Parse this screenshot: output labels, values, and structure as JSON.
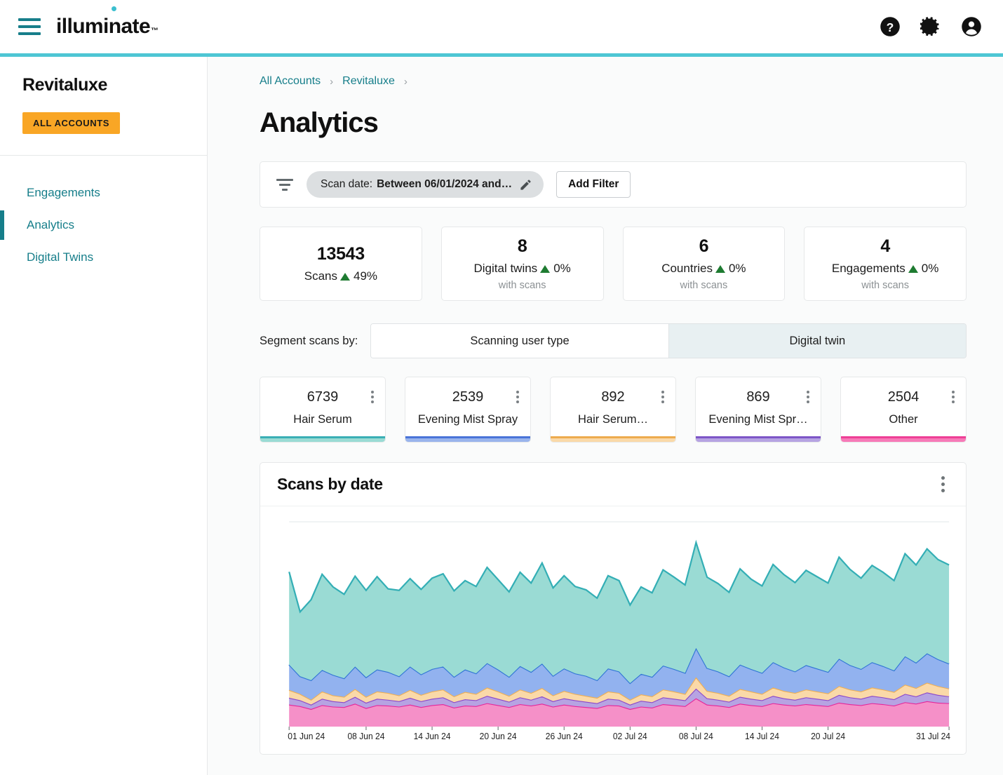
{
  "topbar": {
    "menu_label": "Menu",
    "logo_text": "illuminate",
    "logo_tm": "™",
    "icons": [
      "help-icon",
      "gear-icon",
      "account-icon"
    ],
    "accent_color": "#4ec6d4"
  },
  "sidebar": {
    "account_name": "Revitaluxe",
    "all_accounts_badge": "ALL ACCOUNTS",
    "badge_color": "#f9a625",
    "items": [
      {
        "label": "Engagements",
        "active": false
      },
      {
        "label": "Analytics",
        "active": true
      },
      {
        "label": "Digital Twins",
        "active": false
      }
    ],
    "link_color": "#167e8a"
  },
  "breadcrumb": {
    "items": [
      "All Accounts",
      "Revitaluxe"
    ],
    "separator": "›",
    "trailing_separator": "›"
  },
  "page": {
    "title": "Analytics"
  },
  "filters": {
    "filter_icon": "filter-icon",
    "chip_prefix": "Scan date:",
    "chip_value": "Between 06/01/2024 and…",
    "edit_icon": "pencil-icon",
    "add_filter_label": "Add Filter"
  },
  "stats": [
    {
      "value": "13543",
      "label": "Scans",
      "delta": "49%",
      "delta_dir": "up",
      "sub": ""
    },
    {
      "value": "8",
      "label": "Digital twins",
      "delta": "0%",
      "delta_dir": "up",
      "sub": "with scans"
    },
    {
      "value": "6",
      "label": "Countries",
      "delta": "0%",
      "delta_dir": "up",
      "sub": "with scans"
    },
    {
      "value": "4",
      "label": "Engagements",
      "delta": "0%",
      "delta_dir": "up",
      "sub": "with scans"
    }
  ],
  "segment": {
    "label": "Segment scans by:",
    "options": [
      {
        "label": "Scanning user type",
        "active": false
      },
      {
        "label": "Digital twin",
        "active": true
      }
    ]
  },
  "products": [
    {
      "value": "6739",
      "label": "Hair Serum",
      "color": "#9adbd4",
      "stroke": "#3aafb5"
    },
    {
      "value": "2539",
      "label": "Evening Mist Spray",
      "color": "#9ab4ec",
      "stroke": "#4a74d8"
    },
    {
      "value": "892",
      "label": "Hair Serum…",
      "color": "#fad9a8",
      "stroke": "#edab4e"
    },
    {
      "value": "869",
      "label": "Evening Mist Spr…",
      "color": "#b6a3e2",
      "stroke": "#7d55c7"
    },
    {
      "value": "2504",
      "label": "Other",
      "color": "#f77ab8",
      "stroke": "#ee3f96"
    }
  ],
  "chart_panel": {
    "title": "Scans by date",
    "menu": "kebab-icon"
  },
  "chart_data": {
    "type": "area",
    "title": "Scans by date",
    "stacked": true,
    "xlabel": "",
    "ylabel": "",
    "grid": true,
    "legend_position": "none",
    "ylim": [
      0,
      400
    ],
    "xtick_labels": [
      "01 Jun 24",
      "08 Jun 24",
      "14 Jun 24",
      "20 Jun 24",
      "26 Jun 24",
      "02 Jul 24",
      "08 Jul 24",
      "14 Jul 24",
      "20 Jul 24",
      "31 Jul 24"
    ],
    "xtick_indices": [
      0,
      7,
      13,
      19,
      25,
      31,
      37,
      43,
      49,
      60
    ],
    "x": [
      "01 Jun 24",
      "02 Jun 24",
      "03 Jun 24",
      "04 Jun 24",
      "05 Jun 24",
      "06 Jun 24",
      "07 Jun 24",
      "08 Jun 24",
      "09 Jun 24",
      "10 Jun 24",
      "11 Jun 24",
      "12 Jun 24",
      "13 Jun 24",
      "14 Jun 24",
      "15 Jun 24",
      "16 Jun 24",
      "17 Jun 24",
      "18 Jun 24",
      "19 Jun 24",
      "20 Jun 24",
      "21 Jun 24",
      "22 Jun 24",
      "23 Jun 24",
      "24 Jun 24",
      "25 Jun 24",
      "26 Jun 24",
      "27 Jun 24",
      "28 Jun 24",
      "29 Jun 24",
      "30 Jun 24",
      "01 Jul 24",
      "02 Jul 24",
      "03 Jul 24",
      "04 Jul 24",
      "05 Jul 24",
      "06 Jul 24",
      "07 Jul 24",
      "08 Jul 24",
      "09 Jul 24",
      "10 Jul 24",
      "11 Jul 24",
      "12 Jul 24",
      "13 Jul 24",
      "14 Jul 24",
      "15 Jul 24",
      "16 Jul 24",
      "17 Jul 24",
      "18 Jul 24",
      "19 Jul 24",
      "20 Jul 24",
      "21 Jul 24",
      "22 Jul 24",
      "23 Jul 24",
      "24 Jul 24",
      "25 Jul 24",
      "26 Jul 24",
      "27 Jul 24",
      "28 Jul 24",
      "29 Jul 24",
      "30 Jul 24",
      "31 Jul 24"
    ],
    "series": [
      {
        "name": "Other",
        "color": "#f590c8",
        "stroke": "#e5269a",
        "values": [
          45,
          42,
          36,
          44,
          41,
          40,
          47,
          38,
          44,
          43,
          41,
          45,
          40,
          44,
          46,
          39,
          43,
          42,
          48,
          44,
          40,
          46,
          43,
          47,
          41,
          45,
          42,
          40,
          38,
          44,
          43,
          36,
          41,
          39,
          46,
          44,
          42,
          58,
          45,
          43,
          40,
          47,
          44,
          42,
          48,
          45,
          43,
          46,
          44,
          42,
          49,
          46,
          44,
          48,
          46,
          43,
          50,
          47,
          52,
          49,
          48
        ]
      },
      {
        "name": "Evening Mist Spr…",
        "color": "#b6a3e2",
        "stroke": "#8b46c9",
        "values": [
          14,
          12,
          9,
          13,
          11,
          10,
          14,
          11,
          13,
          12,
          11,
          14,
          12,
          13,
          14,
          11,
          13,
          12,
          15,
          13,
          11,
          14,
          12,
          15,
          11,
          13,
          12,
          11,
          10,
          13,
          12,
          9,
          12,
          11,
          14,
          13,
          12,
          20,
          13,
          12,
          11,
          14,
          13,
          12,
          15,
          13,
          12,
          14,
          13,
          12,
          16,
          14,
          13,
          15,
          14,
          13,
          17,
          15,
          18,
          16,
          14
        ]
      },
      {
        "name": "Hair Serum…",
        "color": "#fad9a8",
        "stroke": "#efae52",
        "values": [
          16,
          13,
          10,
          15,
          12,
          11,
          16,
          12,
          15,
          14,
          12,
          16,
          13,
          15,
          16,
          12,
          15,
          13,
          17,
          15,
          12,
          16,
          14,
          17,
          12,
          15,
          13,
          12,
          11,
          15,
          14,
          10,
          13,
          12,
          16,
          15,
          13,
          23,
          15,
          14,
          12,
          16,
          15,
          13,
          17,
          15,
          14,
          16,
          15,
          14,
          18,
          16,
          15,
          17,
          16,
          15,
          19,
          17,
          20,
          18,
          16
        ]
      },
      {
        "name": "Evening Mist Spray",
        "color": "#92b2ef",
        "stroke": "#2f74d5",
        "values": [
          52,
          36,
          40,
          44,
          42,
          38,
          46,
          40,
          45,
          43,
          39,
          48,
          42,
          46,
          47,
          40,
          46,
          42,
          50,
          45,
          39,
          48,
          43,
          50,
          40,
          46,
          42,
          41,
          36,
          47,
          44,
          34,
          42,
          40,
          49,
          46,
          43,
          60,
          47,
          44,
          40,
          50,
          46,
          43,
          52,
          48,
          44,
          50,
          47,
          44,
          56,
          50,
          46,
          52,
          48,
          44,
          58,
          52,
          60,
          55,
          51
        ]
      },
      {
        "name": "Hair Serum",
        "color": "#9adbd4",
        "stroke": "#33aeb5",
        "values": [
          190,
          132,
          165,
          196,
          180,
          172,
          185,
          178,
          190,
          170,
          176,
          180,
          174,
          186,
          190,
          176,
          182,
          178,
          196,
          184,
          174,
          192,
          182,
          206,
          180,
          190,
          178,
          176,
          168,
          190,
          186,
          160,
          178,
          172,
          196,
          188,
          180,
          216,
          186,
          180,
          172,
          196,
          184,
          178,
          200,
          190,
          182,
          194,
          188,
          182,
          208,
          196,
          186,
          198,
          192,
          184,
          210,
          200,
          214,
          204,
          202
        ]
      }
    ]
  }
}
